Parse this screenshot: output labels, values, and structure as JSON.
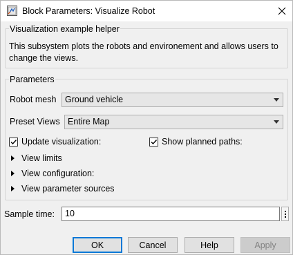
{
  "window": {
    "title": "Block Parameters: Visualize Robot",
    "app_icon": "simulink-block-icon",
    "close_icon": "close-icon"
  },
  "helper": {
    "group_title": "Visualization example helper",
    "description": "This subsystem plots the robots and environement and allows users to change the views."
  },
  "parameters": {
    "group_title": "Parameters",
    "robot_mesh": {
      "label": "Robot mesh",
      "value": "Ground vehicle"
    },
    "preset_views": {
      "label": "Preset Views",
      "value": "Entire Map"
    },
    "update_visualization": {
      "label": "Update visualization:",
      "checked": true
    },
    "show_planned_paths": {
      "label": "Show planned paths:",
      "checked": true
    },
    "sections": [
      {
        "label": "View limits"
      },
      {
        "label": "View configuration:"
      },
      {
        "label": "View parameter sources"
      }
    ]
  },
  "sample_time": {
    "label": "Sample time:",
    "value": "10"
  },
  "buttons": {
    "ok": "OK",
    "cancel": "Cancel",
    "help": "Help",
    "apply": "Apply"
  },
  "colors": {
    "window_bg": "#f0f0f0",
    "default_button_border": "#0078d7",
    "disabled_text": "#838383"
  }
}
